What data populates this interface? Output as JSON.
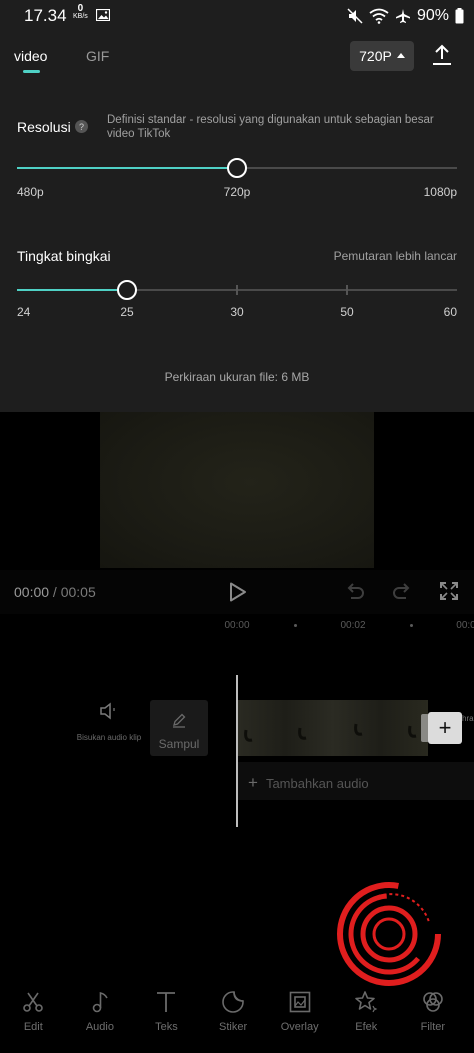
{
  "status_bar": {
    "time": "17.34",
    "net_speed_value": "0",
    "net_speed_unit": "KB/s",
    "battery": "90%"
  },
  "tabs": [
    {
      "label": "video",
      "active": true
    },
    {
      "label": "GIF",
      "active": false
    }
  ],
  "resolution_button": {
    "label": "720P"
  },
  "resolution": {
    "label": "Resolusi",
    "help": "?",
    "description": "Definisi standar - resolusi yang digunakan untuk sebagian besar video TikTok",
    "ticks": [
      "480p",
      "720p",
      "1080p"
    ],
    "selected": "720p",
    "selected_index": 1
  },
  "frame_rate": {
    "label": "Tingkat bingkai",
    "note": "Pemutaran lebih lancar",
    "ticks": [
      "24",
      "25",
      "30",
      "50",
      "60"
    ],
    "selected": "25",
    "selected_index": 1
  },
  "file_size": "Perkiraan ukuran file: 6 MB",
  "player": {
    "current": "00:00",
    "separator": " / ",
    "total": "00:05"
  },
  "ruler": {
    "labels": [
      "00:00",
      "00:02",
      "00:0"
    ]
  },
  "timeline": {
    "mute_label": "Bisukan audio klip",
    "cover_label": "Sampul",
    "add_audio_label": "Tambahkan audio",
    "clip_trail": "hra"
  },
  "toolbar": [
    {
      "label": "Edit",
      "icon": "scissors-icon"
    },
    {
      "label": "Audio",
      "icon": "music-note-icon"
    },
    {
      "label": "Teks",
      "icon": "text-icon"
    },
    {
      "label": "Stiker",
      "icon": "sticker-icon"
    },
    {
      "label": "Overlay",
      "icon": "overlay-icon"
    },
    {
      "label": "Efek",
      "icon": "effects-star-icon"
    },
    {
      "label": "Filter",
      "icon": "filter-icon"
    }
  ],
  "colors": {
    "accent": "#4fd1c5",
    "panel_bg": "#1e1e1e",
    "background": "#000000"
  }
}
